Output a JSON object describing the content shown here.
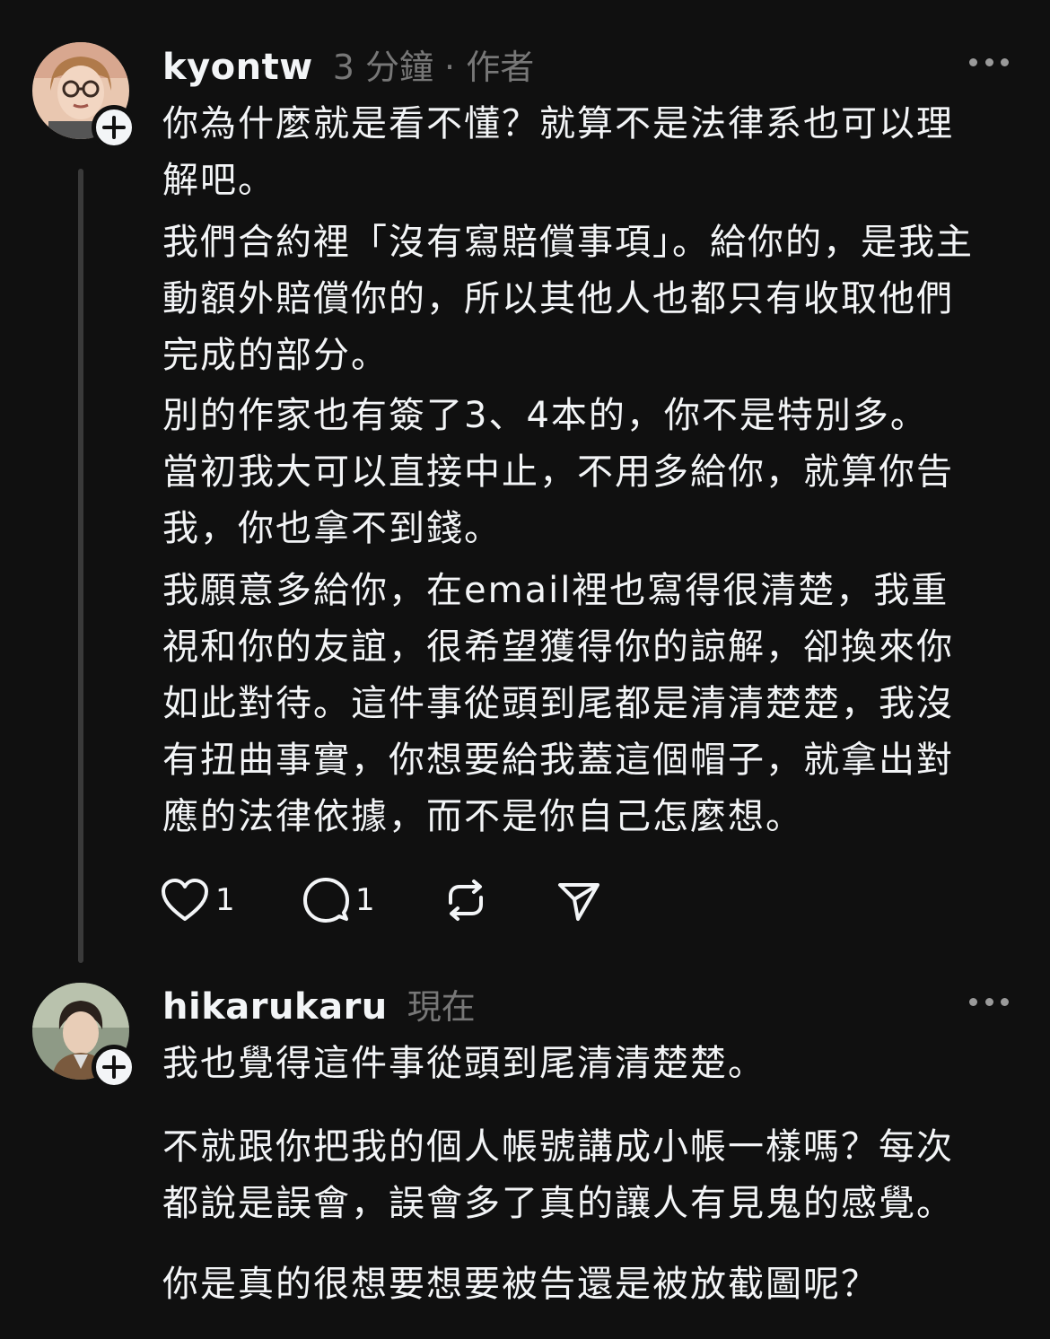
{
  "posts": [
    {
      "username": "kyontw",
      "meta": "3 分鐘 · 作者",
      "avatar_icon": "user-avatar-glasses",
      "paragraphs": [
        "你為什麼就是看不懂？就算不是法律系也可以理\n解吧。",
        "我們合約裡「沒有寫賠償事項」。給你的，是我主\n動額外賠償你的，所以其他人也都只有收取他們\n完成的部分。",
        "別的作家也有簽了3、4本的，你不是特別多。\n當初我大可以直接中止，不用多給你，就算你告\n我，你也拿不到錢。",
        "我願意多給你，在email裡也寫得很清楚，我重\n視和你的友誼，很希望獲得你的諒解，卻換來你\n如此對待。這件事從頭到尾都是清清楚楚，我沒\n有扭曲事實，你想要給我蓋這個帽子，就拿出對\n應的法律依據，而不是你自己怎麼想。"
      ],
      "actions": {
        "likes": "1",
        "replies": "1"
      }
    },
    {
      "username": "hikarukaru",
      "meta": "現在",
      "avatar_icon": "user-avatar-photo",
      "paragraphs": [
        "我也覺得這件事從頭到尾清清楚楚。",
        "不就跟你把我的個人帳號講成小帳一樣嗎？每次\n都說是誤會，誤會多了真的讓人有見鬼的感覺。",
        "你是真的很想要想要被告還是被放截圖呢？"
      ]
    }
  ],
  "colors": {
    "background": "#101010",
    "text": "#f3f5f7",
    "secondary": "#777777",
    "thread_line": "#3a3a3a"
  }
}
